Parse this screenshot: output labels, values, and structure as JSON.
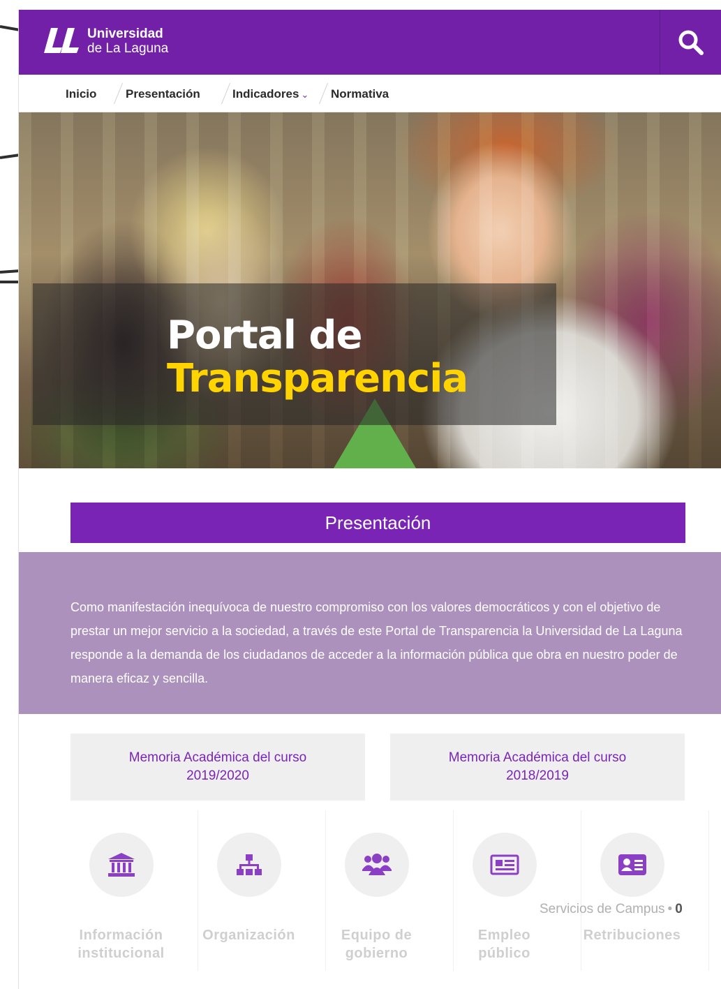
{
  "header": {
    "logo_line1": "Universidad",
    "logo_line2": "de La Laguna",
    "search_icon": "search-icon",
    "bg_color": "#7220a8"
  },
  "nav": {
    "items": [
      {
        "label": "Inicio"
      },
      {
        "label": "Presentación"
      },
      {
        "label": "Indicadores",
        "has_dropdown": true,
        "chevron": "⌄"
      },
      {
        "label": "Normativa"
      }
    ]
  },
  "hero": {
    "title_line1": "Portal de",
    "title_line2": "Transparencia",
    "accent_color": "#ffd400"
  },
  "presentacion": {
    "title": "Presentación",
    "text": "Como manifestación inequívoca de nuestro compromiso con los valores democráticos y con el objetivo de prestar un mejor servicio a la sociedad, a través de este Portal de Transparencia la Universidad de La Laguna responde a la demanda de los ciudadanos de acceder a la información pública que obra en nuestro poder de manera eficaz y sencilla.",
    "title_bg": "#7a24b5",
    "band_bg": "#ad91bd"
  },
  "memorias": [
    {
      "line1": "Memoria Académica del curso",
      "line2": "2019/2020"
    },
    {
      "line1": "Memoria Académica del curso",
      "line2": "2018/2019"
    }
  ],
  "tiles": [
    {
      "icon": "institution-icon",
      "line1": "Información",
      "line2": "institucional"
    },
    {
      "icon": "org-chart-icon",
      "line1": "Organización",
      "line2": ""
    },
    {
      "icon": "team-icon",
      "line1": "Equipo de",
      "line2": "gobierno"
    },
    {
      "icon": "newspaper-icon",
      "line1": "Empleo",
      "line2": "público"
    },
    {
      "icon": "id-card-icon",
      "line1": "Retribuciones",
      "line2": ""
    }
  ],
  "footer_overlay": {
    "text": "Servicios de Campus",
    "separator": "•",
    "trailing": "0"
  }
}
